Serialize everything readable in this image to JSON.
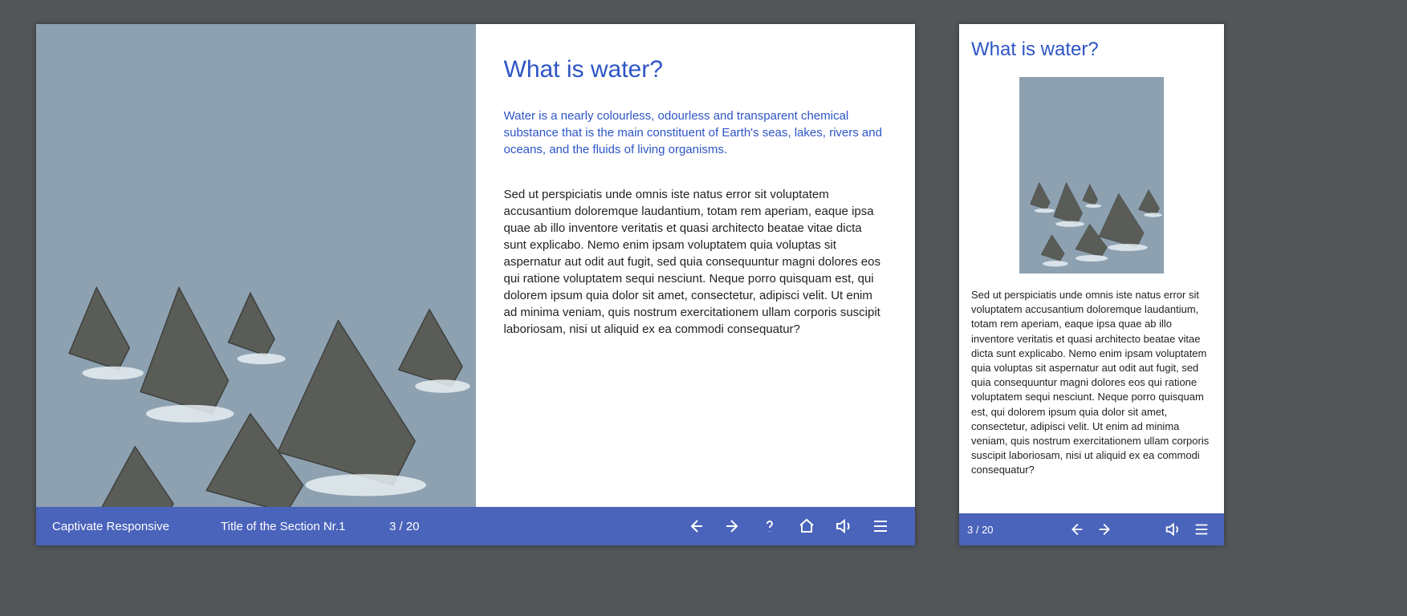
{
  "desktop": {
    "heading": "What is water?",
    "intro": "Water is a nearly colourless, odourless and transparent chemical substance that is the main constituent of Earth's seas, lakes, rivers and oceans, and the fluids of living organisms.",
    "body": "Sed ut perspiciatis unde omnis iste natus error sit voluptatem accusantium doloremque laudantium, totam rem aperiam, eaque ipsa quae ab illo inventore veritatis et quasi architecto beatae vitae dicta sunt explicabo. Nemo enim ipsam voluptatem quia voluptas sit aspernatur aut odit aut fugit, sed quia consequuntur magni dolores eos qui ratione voluptatem sequi nesciunt. Neque porro quisquam est, qui dolorem ipsum quia dolor sit amet, consectetur, adipisci velit. Ut enim ad minima veniam, quis nostrum exercitationem ullam corporis suscipit laboriosam, nisi ut aliquid ex ea commodi consequatur?",
    "nav": {
      "project": "Captivate Responsive",
      "section": "Title of the Section Nr.1",
      "counter": "3 / 20"
    }
  },
  "mobile": {
    "heading": "What is water?",
    "body": "Sed ut perspiciatis unde omnis iste natus error sit voluptatem accusantium doloremque laudantium, totam rem aperiam, eaque ipsa quae ab illo inventore veritatis et quasi architecto beatae vitae dicta sunt explicabo. Nemo enim ipsam voluptatem quia voluptas sit aspernatur aut odit aut fugit, sed quia consequuntur magni dolores eos qui ratione voluptatem sequi nesciunt. Neque porro quisquam est, qui dolorem ipsum quia dolor sit amet, consectetur, adipisci velit. Ut enim ad minima veniam, quis nostrum exercitationem ullam corporis suscipit laboriosam, nisi ut aliquid ex ea commodi consequatur?",
    "nav": {
      "counter": "3 / 20"
    }
  }
}
